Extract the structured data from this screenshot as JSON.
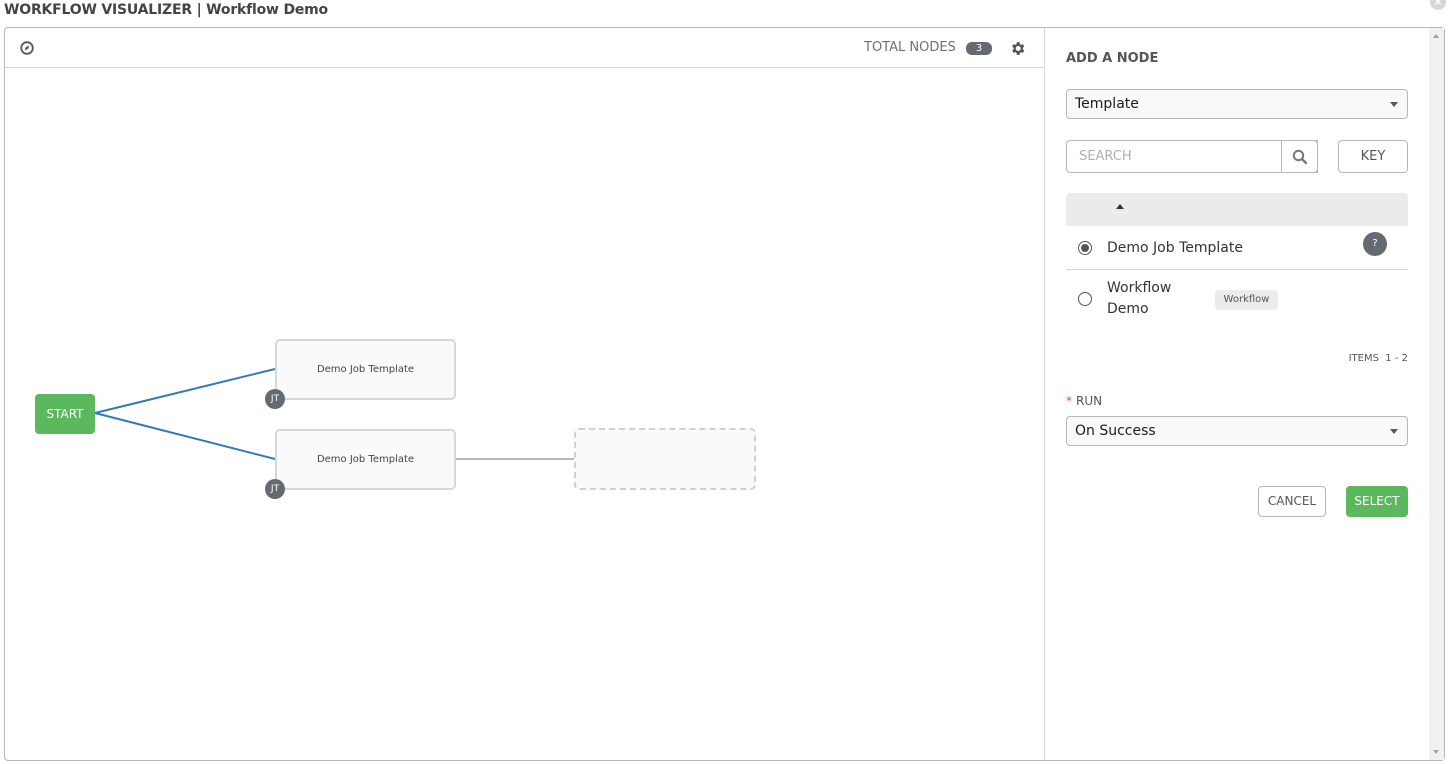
{
  "header": {
    "title": "WORKFLOW VISUALIZER | Workflow Demo",
    "close_icon": "close-icon"
  },
  "toolbar": {
    "compass_icon": "compass-icon",
    "total_nodes_label": "TOTAL NODES",
    "total_nodes_count": "3",
    "settings_icon": "gear-icon"
  },
  "graph": {
    "start_label": "START",
    "nodes": [
      {
        "label": "Demo Job Template",
        "badge": "JT"
      },
      {
        "label": "Demo Job Template",
        "badge": "JT"
      }
    ],
    "placeholder_node": "empty",
    "edge_colors": {
      "success_link": "#337ab7",
      "pending_link": "#b7b7b7"
    }
  },
  "panel": {
    "title": "ADD A NODE",
    "node_type_select": "Template",
    "search_placeholder": "SEARCH",
    "key_button": "KEY",
    "list": [
      {
        "label": "Demo Job Template",
        "selected": true,
        "help": "?"
      },
      {
        "label": "Workflow Demo",
        "selected": false,
        "tag": "Workflow"
      }
    ],
    "items_count": "ITEMS  1 - 2",
    "run_label": "RUN",
    "run_required": "*",
    "run_select": "On Success",
    "cancel_button": "CANCEL",
    "select_button": "SELECT"
  },
  "colors": {
    "start": "#5cb85c",
    "select_button": "#5cb85c",
    "badge": "#646972"
  }
}
